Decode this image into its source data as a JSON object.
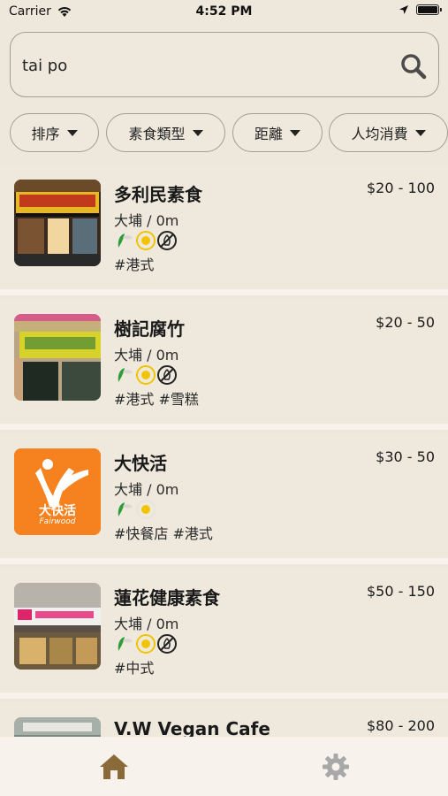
{
  "status_bar": {
    "carrier": "Carrier",
    "time": "4:52 PM"
  },
  "search": {
    "value": "tai po",
    "placeholder": ""
  },
  "filters": [
    {
      "label": "排序"
    },
    {
      "label": "素食類型"
    },
    {
      "label": "距離"
    },
    {
      "label": "人均消費"
    }
  ],
  "restaurants": [
    {
      "name": "多利民素食",
      "price": "$20 - 100",
      "location": "大埔 / 0m",
      "tags": "#港式",
      "badges": [
        "vegan-leaf",
        "egg",
        "no-onion-garlic"
      ]
    },
    {
      "name": "樹記腐竹",
      "price": "$20 - 50",
      "location": "大埔 / 0m",
      "tags": "#港式 #雪糕",
      "badges": [
        "vegan-leaf",
        "egg",
        "no-onion-garlic"
      ]
    },
    {
      "name": "大快活",
      "price": "$30 - 50",
      "location": "大埔 / 0m",
      "tags": "#快餐店 #港式",
      "badges": [
        "vegan-leaf",
        "egg"
      ]
    },
    {
      "name": "蓮花健康素食",
      "price": "$50 - 150",
      "location": "大埔 / 0m",
      "tags": "#中式",
      "badges": [
        "vegan-leaf",
        "egg",
        "no-onion-garlic"
      ]
    },
    {
      "name": "V.W Vegan Cafe",
      "price": "$80 - 200",
      "location": "",
      "tags": "",
      "badges": []
    }
  ],
  "tab_bar": {
    "items": [
      {
        "icon": "home-icon",
        "active": true
      },
      {
        "icon": "gear-icon",
        "active": false
      }
    ]
  },
  "colors": {
    "background": "#eee8dc",
    "accent_brown": "#8b6a3a",
    "leaf_green": "#2f9b3a",
    "egg_yellow": "#f0c400",
    "fairwood_orange": "#f5821f"
  },
  "images": {
    "fairwood_logo_text": "大快活",
    "fairwood_logo_subtext": "Fairwood"
  }
}
